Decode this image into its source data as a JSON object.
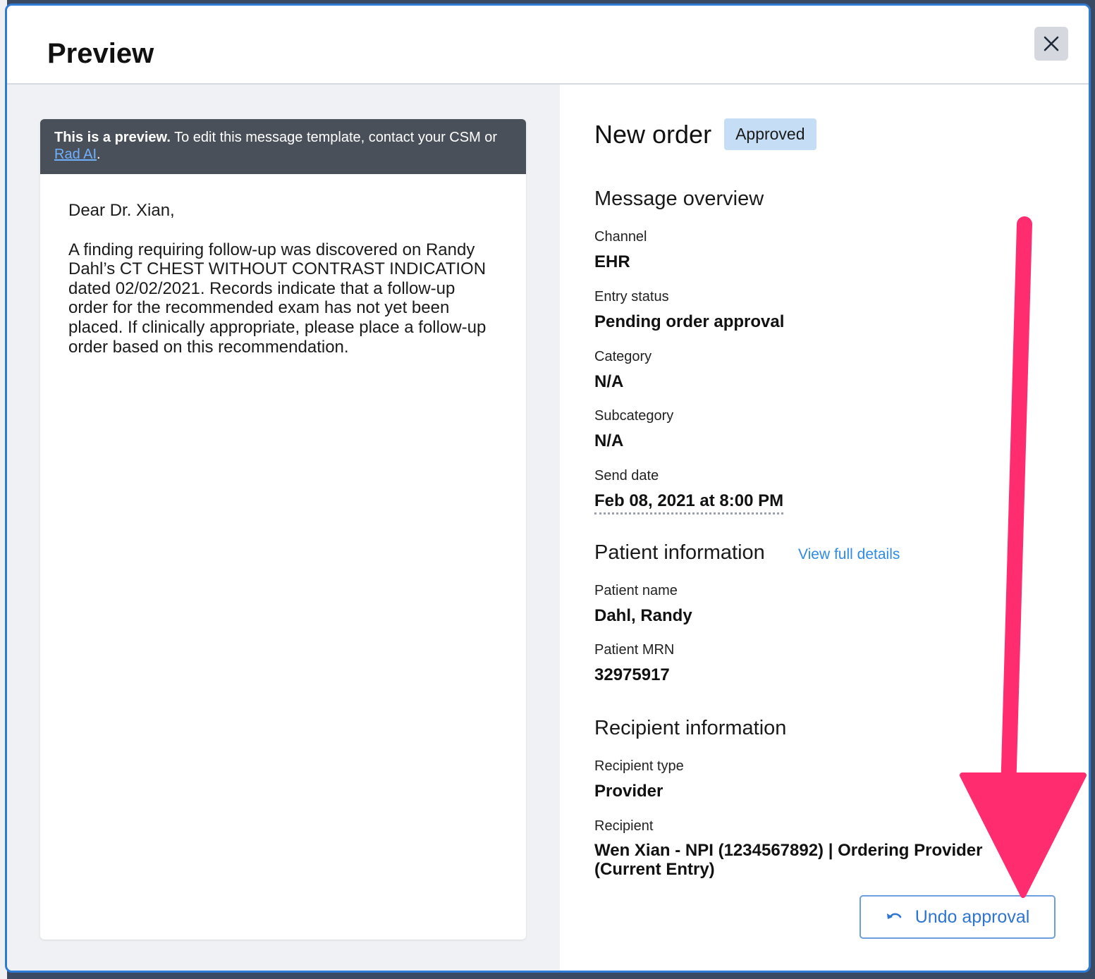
{
  "modal": {
    "title": "Preview"
  },
  "preview": {
    "banner_bold": "This is a preview.",
    "banner_text": " To edit this message template, contact your CSM or ",
    "banner_link": "Rad AI",
    "banner_end": ".",
    "greeting": "Dear Dr. Xian,",
    "body": "A finding requiring follow-up was discovered on Randy Dahl’s CT CHEST WITHOUT CONTRAST INDICATION dated 02/02/2021.  Records indicate that a follow-up order for the recommended exam has not yet been placed.  If clinically appropriate, please place a follow-up order based on this recommendation."
  },
  "order": {
    "title": "New order",
    "status_badge": "Approved"
  },
  "overview": {
    "heading": "Message overview",
    "channel_label": "Channel",
    "channel_value": "EHR",
    "entry_status_label": "Entry status",
    "entry_status_value": "Pending order approval",
    "category_label": "Category",
    "category_value": "N/A",
    "subcategory_label": "Subcategory",
    "subcategory_value": "N/A",
    "send_date_label": "Send date",
    "send_date_value": "Feb 08, 2021 at 8:00 PM"
  },
  "patient": {
    "heading": "Patient information",
    "view_link": "View full details",
    "name_label": "Patient name",
    "name_value": "Dahl, Randy",
    "mrn_label": "Patient MRN",
    "mrn_value": "32975917"
  },
  "recipient": {
    "heading": "Recipient information",
    "type_label": "Recipient type",
    "type_value": "Provider",
    "recipient_label": "Recipient",
    "recipient_value": "Wen Xian - NPI (1234567892) | Ordering Provider (Current Entry)"
  },
  "actions": {
    "undo_label": "Undo approval"
  },
  "colors": {
    "accent": "#2e75d1",
    "badge_bg": "#c5def5",
    "banner_bg": "#4a5059",
    "annotation_arrow": "#ff2d6f"
  },
  "icons": {
    "close": "close-icon",
    "undo": "undo-icon"
  }
}
